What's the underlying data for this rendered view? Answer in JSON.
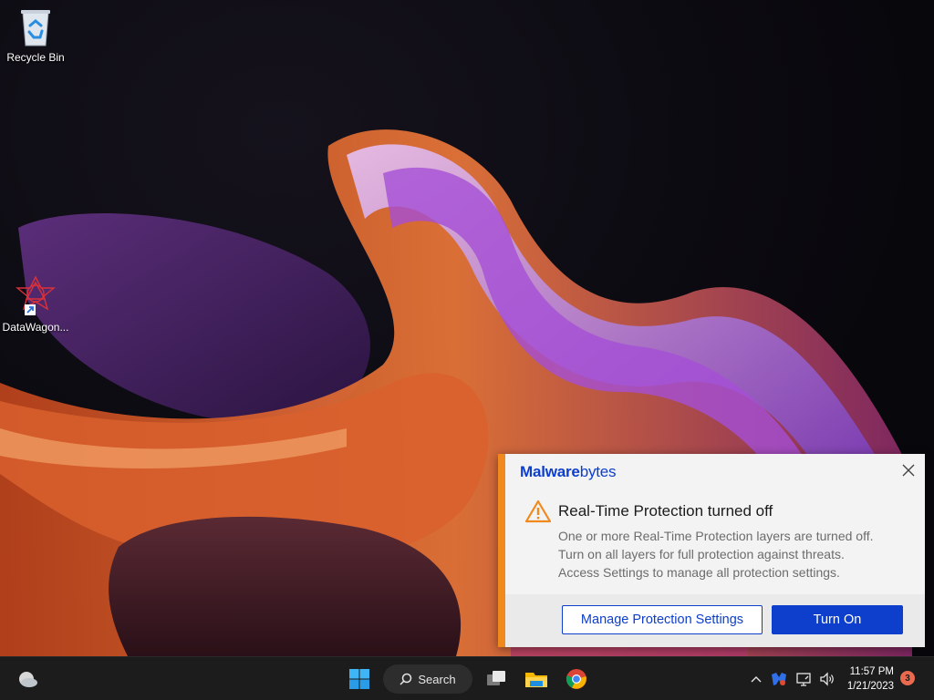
{
  "desktop": {
    "icons": [
      {
        "label": "Recycle Bin",
        "icon": "recycle-bin-icon"
      },
      {
        "label": "DataWagon...",
        "icon": "datawagon-shortcut-icon"
      }
    ]
  },
  "toast": {
    "brand_bold": "Malware",
    "brand_light": "bytes",
    "title": "Real-Time Protection turned off",
    "body_lines": [
      "One or more Real-Time Protection layers are turned off.",
      "Turn on all layers for full protection against threats.",
      "Access Settings to manage all protection settings."
    ],
    "secondary_button": "Manage Protection Settings",
    "primary_button": "Turn On",
    "accent_color": "#f08a1e",
    "brand_color": "#0d3ecc"
  },
  "taskbar": {
    "search_label": "Search",
    "apps": [
      "start-icon",
      "search-pill",
      "task-view-icon",
      "file-explorer-icon",
      "chrome-icon"
    ],
    "tray": {
      "time": "11:57 PM",
      "date": "1/21/2023",
      "notification_count": "3"
    }
  }
}
